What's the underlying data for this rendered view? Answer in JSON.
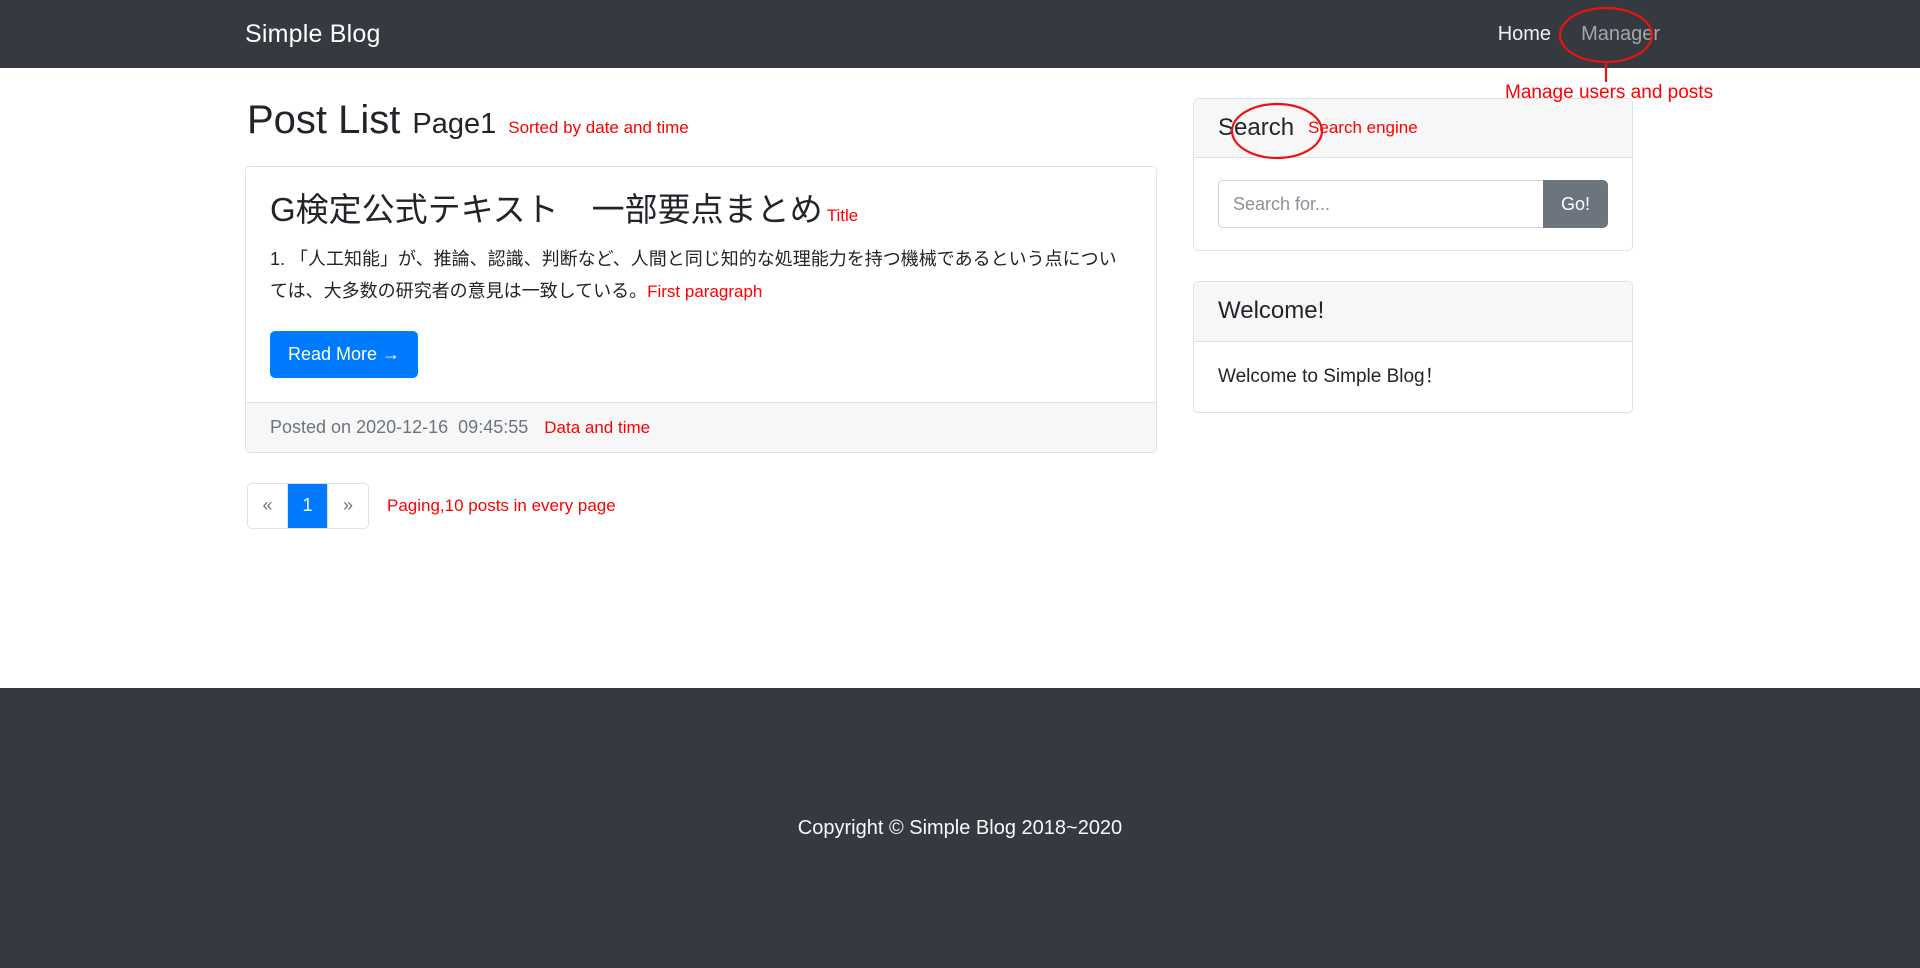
{
  "navbar": {
    "brand": "Simple Blog",
    "links": [
      {
        "label": "Home",
        "active": true
      },
      {
        "label": "Manager",
        "active": false
      }
    ]
  },
  "annotations": {
    "manager": "Manage users and posts",
    "sorted": "Sorted by date and time",
    "title": "Title",
    "first_paragraph": "First paragraph",
    "date_time": "Data and time",
    "paging": "Paging,10 posts in every page",
    "search_engine": "Search engine",
    "color": "#ff0000"
  },
  "main": {
    "page_title": "Post List",
    "page_sub": "Page1",
    "post": {
      "title": "G検定公式テキスト　一部要点まとめ",
      "excerpt": "1. 「人工知能」が、推論、認識、判断など、人間と同じ知的な処理能力を持つ機械であるという点については、大多数の研究者の意見は一致している。",
      "read_more_label": "Read More →",
      "posted_prefix": "Posted on",
      "posted_date": "2020-12-16",
      "posted_time": "09:45:55"
    },
    "pagination": {
      "prev": "«",
      "next": "»",
      "pages": [
        "1"
      ],
      "active_page": "1"
    }
  },
  "sidebar": {
    "search_card": {
      "header": "Search",
      "placeholder": "Search for...",
      "value": "",
      "button_label": "Go!"
    },
    "welcome_card": {
      "header": "Welcome!",
      "body": "Welcome to Simple Blog！"
    }
  },
  "footer": {
    "copyright": "Copyright © Simple Blog 2018~2020"
  },
  "theme": {
    "navbar_bg": "#343a40",
    "primary": "#007bff",
    "secondary": "#6c757d",
    "card_header_bg": "#f7f7f8"
  }
}
